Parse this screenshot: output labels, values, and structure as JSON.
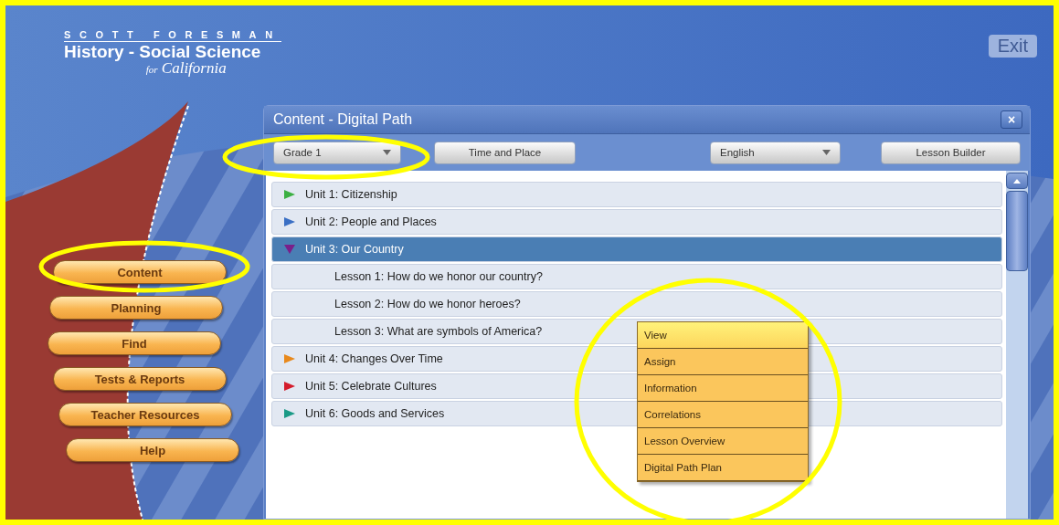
{
  "logo": {
    "brand": "SCOTT FORESMAN",
    "title": "History - Social Science",
    "subtitle_prefix": "for",
    "subtitle": "California"
  },
  "exit_button": {
    "label": "Exit",
    "disabled": true
  },
  "nav": [
    {
      "label": "Content"
    },
    {
      "label": "Planning"
    },
    {
      "label": "Find"
    },
    {
      "label": "Tests & Reports"
    },
    {
      "label": "Teacher Resources"
    },
    {
      "label": "Help"
    }
  ],
  "panel": {
    "title": "Content - Digital Path",
    "close": "×",
    "toolbar": [
      {
        "kind": "dropdown",
        "value": "Grade 1"
      },
      {
        "kind": "button",
        "label": "Time and Place"
      },
      {
        "kind": "dropdown",
        "value": "English"
      },
      {
        "kind": "button",
        "label": "Lesson Builder"
      }
    ],
    "tree": [
      {
        "label": "Unit 1: Citizenship",
        "color": "#3cb043",
        "expanded": false,
        "selected": false
      },
      {
        "label": "Unit 2: People and Places",
        "color": "#3a6fc4",
        "expanded": false,
        "selected": false
      },
      {
        "label": "Unit 3: Our Country",
        "color": "#7a1f8a",
        "expanded": true,
        "selected": true,
        "children": [
          {
            "label": "Lesson 1: How do we honor our country?",
            "selected": false
          },
          {
            "label": "Lesson 2: How do we honor heroes?",
            "selected": false
          },
          {
            "label": "Lesson 3: What are symbols of America?",
            "selected": false
          }
        ]
      },
      {
        "label": "Unit 4: Changes Over Time",
        "color": "#e8891c",
        "expanded": false,
        "selected": false
      },
      {
        "label": "Unit 5: Celebrate Cultures",
        "color": "#d41c2c",
        "expanded": false,
        "selected": false
      },
      {
        "label": "Unit 6: Goods and Services",
        "color": "#1a9a86",
        "expanded": false,
        "selected": false
      }
    ],
    "context_menu": [
      {
        "label": "View",
        "selected": true
      },
      {
        "label": "Assign",
        "selected": false
      },
      {
        "label": "Information",
        "selected": false
      },
      {
        "label": "Correlations",
        "selected": false
      },
      {
        "label": "Lesson Overview",
        "selected": false
      },
      {
        "label": "Digital Path Plan",
        "selected": false
      }
    ]
  }
}
